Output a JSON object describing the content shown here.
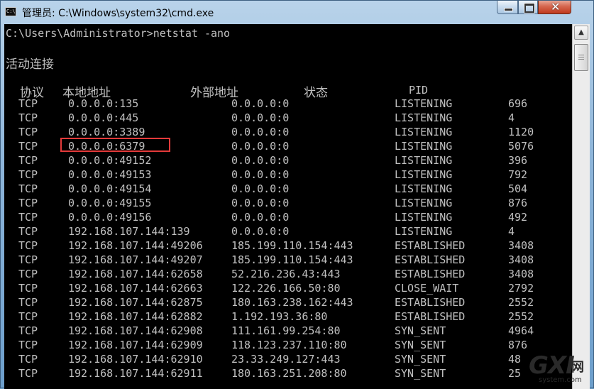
{
  "window": {
    "title": "管理员: C:\\Windows\\system32\\cmd.exe",
    "icon_label": "C:\\"
  },
  "console": {
    "command_line": "C:\\Users\\Administrator>netstat -ano",
    "section_title": "活动连接",
    "headers": {
      "proto": "协议",
      "local": "本地地址",
      "foreign": "外部地址",
      "state": "状态",
      "pid": "PID"
    },
    "rows": [
      {
        "proto": "TCP",
        "local": "0.0.0.0:135",
        "foreign": "0.0.0.0:0",
        "state": "LISTENING",
        "pid": "696"
      },
      {
        "proto": "TCP",
        "local": "0.0.0.0:445",
        "foreign": "0.0.0.0:0",
        "state": "LISTENING",
        "pid": "4"
      },
      {
        "proto": "TCP",
        "local": "0.0.0.0:3389",
        "foreign": "0.0.0.0:0",
        "state": "LISTENING",
        "pid": "1120"
      },
      {
        "proto": "TCP",
        "local": "0.0.0.0:6379",
        "foreign": "0.0.0.0:0",
        "state": "LISTENING",
        "pid": "5076"
      },
      {
        "proto": "TCP",
        "local": "0.0.0.0:49152",
        "foreign": "0.0.0.0:0",
        "state": "LISTENING",
        "pid": "396"
      },
      {
        "proto": "TCP",
        "local": "0.0.0.0:49153",
        "foreign": "0.0.0.0:0",
        "state": "LISTENING",
        "pid": "792"
      },
      {
        "proto": "TCP",
        "local": "0.0.0.0:49154",
        "foreign": "0.0.0.0:0",
        "state": "LISTENING",
        "pid": "504"
      },
      {
        "proto": "TCP",
        "local": "0.0.0.0:49155",
        "foreign": "0.0.0.0:0",
        "state": "LISTENING",
        "pid": "876"
      },
      {
        "proto": "TCP",
        "local": "0.0.0.0:49156",
        "foreign": "0.0.0.0:0",
        "state": "LISTENING",
        "pid": "492"
      },
      {
        "proto": "TCP",
        "local": "192.168.107.144:139",
        "foreign": "0.0.0.0:0",
        "state": "LISTENING",
        "pid": "4"
      },
      {
        "proto": "TCP",
        "local": "192.168.107.144:49206",
        "foreign": "185.199.110.154:443",
        "state": "ESTABLISHED",
        "pid": "3408"
      },
      {
        "proto": "TCP",
        "local": "192.168.107.144:49207",
        "foreign": "185.199.110.154:443",
        "state": "ESTABLISHED",
        "pid": "3408"
      },
      {
        "proto": "TCP",
        "local": "192.168.107.144:62658",
        "foreign": "52.216.236.43:443",
        "state": "ESTABLISHED",
        "pid": "3408"
      },
      {
        "proto": "TCP",
        "local": "192.168.107.144:62663",
        "foreign": "122.226.166.50:80",
        "state": "CLOSE_WAIT",
        "pid": "2792"
      },
      {
        "proto": "TCP",
        "local": "192.168.107.144:62875",
        "foreign": "180.163.238.162:443",
        "state": "ESTABLISHED",
        "pid": "2552"
      },
      {
        "proto": "TCP",
        "local": "192.168.107.144:62882",
        "foreign": "1.192.193.36:80",
        "state": "ESTABLISHED",
        "pid": "2552"
      },
      {
        "proto": "TCP",
        "local": "192.168.107.144:62908",
        "foreign": "111.161.99.254:80",
        "state": "SYN_SENT",
        "pid": "4964"
      },
      {
        "proto": "TCP",
        "local": "192.168.107.144:62909",
        "foreign": "118.123.237.110:80",
        "state": "SYN_SENT",
        "pid": "876"
      },
      {
        "proto": "TCP",
        "local": "192.168.107.144:62910",
        "foreign": "23.33.249.127:443",
        "state": "SYN_SENT",
        "pid": "48"
      },
      {
        "proto": "TCP",
        "local": "192.168.107.144:62911",
        "foreign": "180.163.251.208:80",
        "state": "SYN_SENT",
        "pid": "25"
      }
    ]
  },
  "watermark": {
    "brand": "GXI",
    "cn": "网",
    "domain": "system.com"
  },
  "colors": {
    "console_bg": "#000000",
    "console_text": "#c0c0c0",
    "highlight": "#e33a3a"
  }
}
